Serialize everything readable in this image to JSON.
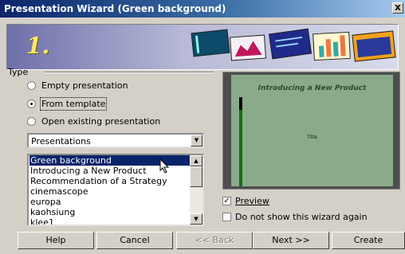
{
  "window": {
    "title": "Presentation Wizard (Green background)",
    "close_label": "X"
  },
  "banner": {
    "step": "1."
  },
  "type_group": {
    "label": "Type"
  },
  "radios": [
    {
      "label": "Empty presentation",
      "selected": false
    },
    {
      "label": "From template",
      "selected": true
    },
    {
      "label": "Open existing presentation",
      "selected": false
    }
  ],
  "category_combo": {
    "value": "Presentations"
  },
  "templates": {
    "items": [
      "Green background",
      "Introducing a New Product",
      "Recommendation of a Strategy",
      "cinemascope",
      "europa",
      "kaohsiung",
      "klee1"
    ],
    "selected": "Green background"
  },
  "preview": {
    "slide_title": "Introducing a New Product",
    "slide_subtitle": "Title",
    "background_color": "#8aab8a",
    "accent_color": "#1b6b1b"
  },
  "options": {
    "preview_label": "Preview",
    "preview_checked": true,
    "dont_show_label": "Do not show this wizard again",
    "dont_show_checked": false
  },
  "buttons": {
    "help": "Help",
    "cancel": "Cancel",
    "back": "<< Back",
    "next": "Next >>",
    "create": "Create"
  }
}
